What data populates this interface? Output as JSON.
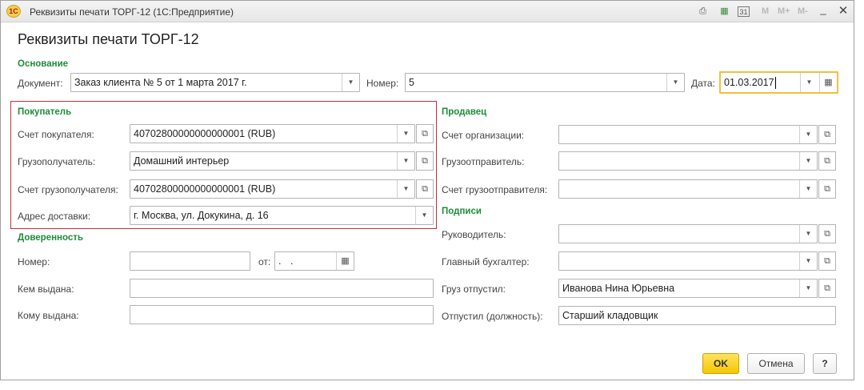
{
  "window": {
    "logo": "1С",
    "title": "Реквизиты печати ТОРГ-12  (1С:Предприятие)",
    "toolbar": {
      "m": "M",
      "mplus": "M+",
      "mminus": "M-"
    }
  },
  "form": {
    "title": "Реквизиты печати ТОРГ-12"
  },
  "basis": {
    "section": "Основание",
    "document_label": "Документ:",
    "document_value": "Заказ клиента № 5 от 1 марта 2017 г.",
    "number_label": "Номер:",
    "number_value": "5",
    "date_label": "Дата:",
    "date_value": "01.03.2017"
  },
  "buyer": {
    "section": "Покупатель",
    "account_label": "Счет покупателя:",
    "account_value": "40702800000000000001 (RUB)",
    "consignee_label": "Грузополучатель:",
    "consignee_value": "Домашний интерьер",
    "consignee_account_label": "Счет грузополучателя:",
    "consignee_account_value": "40702800000000000001 (RUB)",
    "address_label": "Адрес доставки:",
    "address_value": "г. Москва, ул. Докукина, д. 16"
  },
  "seller": {
    "section": "Продавец",
    "org_account_label": "Счет организации:",
    "org_account_value": "",
    "shipper_label": "Грузоотправитель:",
    "shipper_value": "",
    "shipper_account_label": "Счет грузоотправителя:",
    "shipper_account_value": ""
  },
  "proxy": {
    "section": "Доверенность",
    "number_label": "Номер:",
    "number_value": "",
    "from_label": "от:",
    "from_value": " .  .",
    "issued_by_label": "Кем выдана:",
    "issued_by_value": "",
    "issued_to_label": "Кому выдана:",
    "issued_to_value": ""
  },
  "signatures": {
    "section": "Подписи",
    "head_label": "Руководитель:",
    "head_value": "",
    "accountant_label": "Главный бухгалтер:",
    "accountant_value": "",
    "released_label": "Груз отпустил:",
    "released_value": "Иванова Нина Юрьевна",
    "position_label": "Отпустил (должность):",
    "position_value": "Старший кладовщик"
  },
  "buttons": {
    "ok": "OK",
    "cancel": "Отмена",
    "help": "?"
  },
  "icons": {
    "dropdown": "▼",
    "open": "⧉",
    "calendar": "▦"
  },
  "colors": {
    "section": "#1e8c3a",
    "highlight": "#f0c040",
    "frame": "#c0303a",
    "ok": "#f5c800"
  }
}
